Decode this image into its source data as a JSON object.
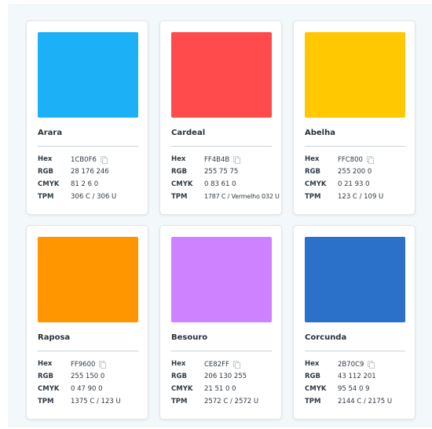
{
  "labels": {
    "hex": "Hex",
    "rgb": "RGB",
    "cmyk": "CMYK",
    "tpm": "TPM"
  },
  "icons": {
    "copy": "copy-icon"
  },
  "colors": [
    {
      "name": "Arara",
      "hex": "1CB0F6",
      "rgb": "28 176 246",
      "cmyk": "81 2 6 0",
      "tpm": "306 C / 306 U",
      "swatch": "#1CB0F6"
    },
    {
      "name": "Cardeal",
      "hex": "FF4B4B",
      "rgb": "255 75 75",
      "cmyk": "0 83 61 0",
      "tpm": "1787 C / Vermelho 032 U",
      "swatch": "#FF4B4B"
    },
    {
      "name": "Abelha",
      "hex": "FFC800",
      "rgb": "255 200 0",
      "cmyk": "0 21 93 0",
      "tpm": "123 C / 109 U",
      "swatch": "#FFC800"
    },
    {
      "name": "Raposa",
      "hex": "FF9600",
      "rgb": "255 150 0",
      "cmyk": "0 47 90 0",
      "tpm": "1375 C / 123 U",
      "swatch": "#FF9600"
    },
    {
      "name": "Besouro",
      "hex": "CE82FF",
      "rgb": "206 130 255",
      "cmyk": "21 51 0 0",
      "tpm": "2572 C / 2572 U",
      "swatch": "#CE82FF"
    },
    {
      "name": "Corcunda",
      "hex": "2B70C9",
      "rgb": "43 112 201",
      "cmyk": "95 54 0 9",
      "tpm": "2144 C / 2175 U",
      "swatch": "#2B70C9"
    }
  ]
}
